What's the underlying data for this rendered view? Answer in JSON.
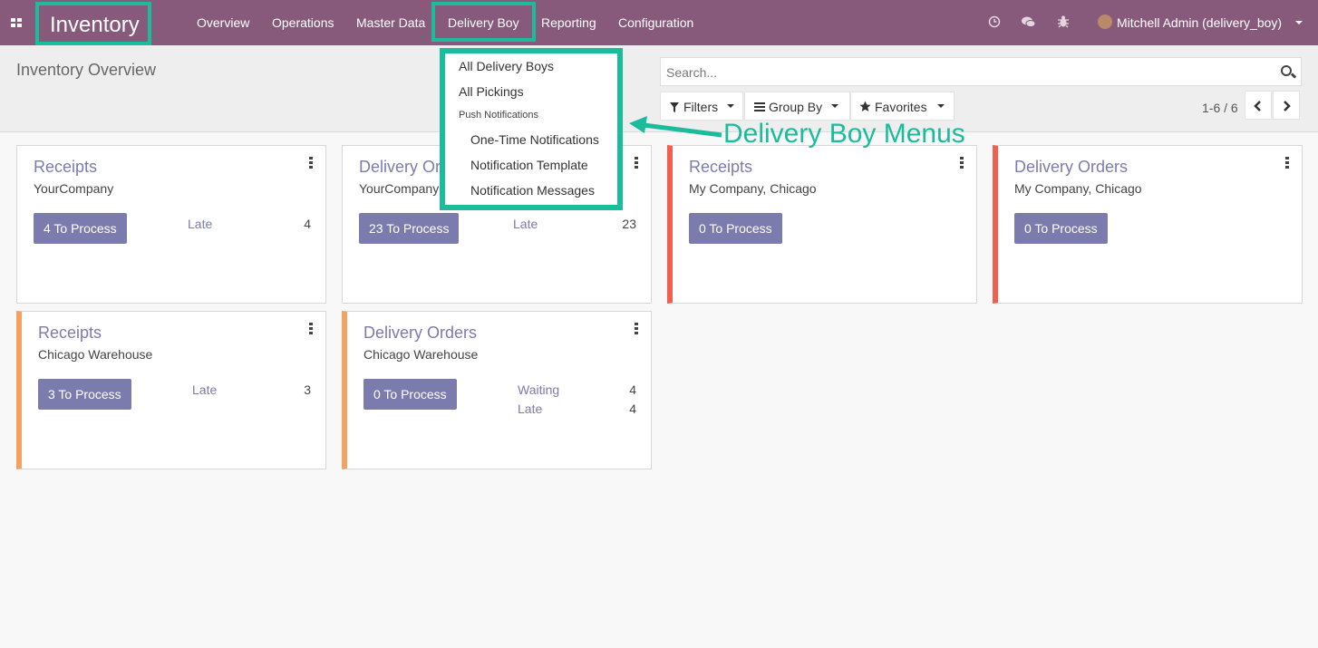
{
  "navbar": {
    "app_name": "Inventory",
    "menu": [
      "Overview",
      "Operations",
      "Master Data",
      "Delivery Boy",
      "Reporting",
      "Configuration"
    ],
    "user": "Mitchell Admin (delivery_boy)"
  },
  "control_panel": {
    "title": "Inventory Overview",
    "search_placeholder": "Search...",
    "filters": "Filters",
    "group_by": "Group By",
    "favorites": "Favorites",
    "pager": "1-6 / 6"
  },
  "dropdown": {
    "items": [
      "All Delivery Boys",
      "All Pickings"
    ],
    "section_header": "Push Notifications",
    "sub_items": [
      "One-Time Notifications",
      "Notification Template",
      "Notification Messages"
    ]
  },
  "annotation": "Delivery Boy Menus",
  "cards": [
    {
      "title": "Receipts",
      "subtitle": "YourCompany",
      "button": "4 To Process",
      "stats": [
        {
          "label": "Late",
          "value": "4"
        }
      ]
    },
    {
      "title": "Delivery Orders",
      "subtitle": "YourCompany",
      "button": "23 To Process",
      "stats": [
        {
          "label": "Late",
          "value": "23"
        }
      ]
    },
    {
      "title": "Receipts",
      "subtitle": "My Company, Chicago",
      "button": "0 To Process",
      "stats": []
    },
    {
      "title": "Delivery Orders",
      "subtitle": "My Company, Chicago",
      "button": "0 To Process",
      "stats": []
    },
    {
      "title": "Receipts",
      "subtitle": "Chicago Warehouse",
      "button": "3 To Process",
      "stats": [
        {
          "label": "Late",
          "value": "3"
        }
      ]
    },
    {
      "title": "Delivery Orders",
      "subtitle": "Chicago Warehouse",
      "button": "0 To Process",
      "stats": [
        {
          "label": "Waiting",
          "value": "4"
        },
        {
          "label": "Late",
          "value": "4"
        }
      ]
    }
  ],
  "colors": {
    "navbar": "#875a7b",
    "highlight": "#1abc9c",
    "accent": "#7c7bad",
    "status_red": "#f0604d",
    "status_orange": "#f4a261"
  }
}
